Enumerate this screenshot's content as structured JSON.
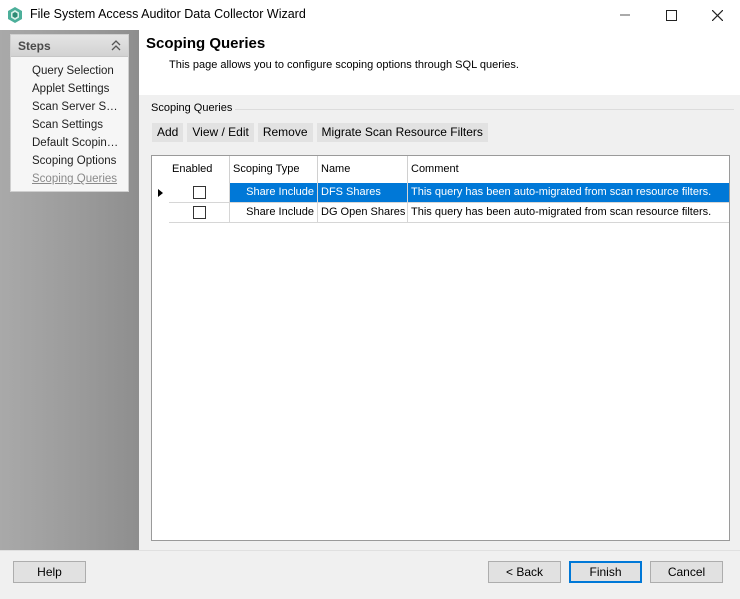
{
  "window": {
    "title": "File System Access Auditor Data Collector Wizard",
    "accent": "#0078d7"
  },
  "steps": {
    "header": "Steps",
    "items": [
      {
        "label": "Query Selection"
      },
      {
        "label": "Applet Settings"
      },
      {
        "label": "Scan Server Selection"
      },
      {
        "label": "Scan Settings"
      },
      {
        "label": "Default Scoping Options"
      },
      {
        "label": "Scoping Options"
      },
      {
        "label": "Scoping Queries",
        "active": true
      }
    ]
  },
  "page": {
    "title": "Scoping Queries",
    "description": "This page allows you to configure scoping options through SQL queries."
  },
  "group": {
    "label": "Scoping Queries"
  },
  "toolbar": {
    "add": "Add",
    "view_edit": "View / Edit",
    "remove": "Remove",
    "migrate": "Migrate Scan Resource Filters"
  },
  "grid": {
    "columns": [
      "Enabled",
      "Scoping Type",
      "Name",
      "Comment"
    ],
    "rows": [
      {
        "enabled": false,
        "type": "Share Include",
        "name": "DFS Shares",
        "comment": "This query has been auto-migrated from scan resource filters.",
        "selected": true
      },
      {
        "enabled": false,
        "type": "Share Include",
        "name": "DG Open Shares",
        "comment": "This query has been auto-migrated from scan resource filters.",
        "selected": false
      }
    ]
  },
  "buttons": {
    "help": "Help",
    "back": "< Back",
    "finish": "Finish",
    "cancel": "Cancel"
  }
}
